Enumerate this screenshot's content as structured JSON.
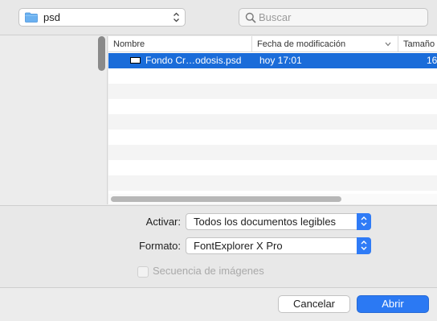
{
  "toolbar": {
    "location": "psd",
    "location_icon": "folder-icon",
    "search_placeholder": "Buscar"
  },
  "columns": {
    "name": "Nombre",
    "date": "Fecha de modificación",
    "size": "Tamaño"
  },
  "files": [
    {
      "name": "Fondo Cr…odosis.psd",
      "date": "hoy 17:01",
      "size": "16",
      "selected": true
    }
  ],
  "options": {
    "activar_label": "Activar:",
    "activar_value": "Todos los documentos legibles",
    "formato_label": "Formato:",
    "formato_value": "FontExplorer X Pro",
    "secuencia_label": "Secuencia de imágenes"
  },
  "buttons": {
    "cancel": "Cancelar",
    "open": "Abrir"
  },
  "colors": {
    "selection": "#1a6cd9",
    "accent": "#2b79f3"
  }
}
